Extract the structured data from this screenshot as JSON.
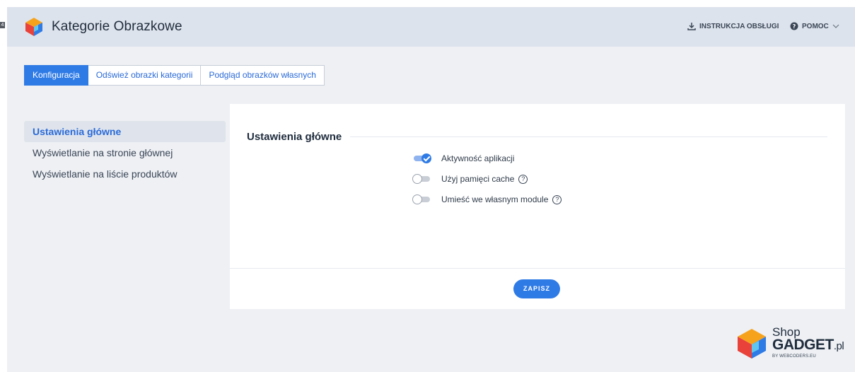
{
  "colors": {
    "accent": "#2f7be6",
    "header_bg": "#dde3ec",
    "page_bg": "#eef0f4",
    "panel_bg": "#ffffff"
  },
  "header": {
    "title": "Kategorie Obrazkowe",
    "logo_icon": "cube-logo-icon",
    "edge_tab": "4",
    "manual_label": "INSTRUKCJA OBSŁUGI",
    "manual_icon": "download-icon",
    "help_label": "POMOC",
    "help_icon": "question-circle-icon",
    "help_chevron": "chevron-down-icon"
  },
  "tabs": [
    {
      "label": "Konfiguracja",
      "active": true
    },
    {
      "label": "Odśwież obrazki kategorii",
      "active": false
    },
    {
      "label": "Podgląd obrazków własnych",
      "active": false
    }
  ],
  "sidebar": {
    "items": [
      {
        "label": "Ustawienia główne",
        "active": true
      },
      {
        "label": "Wyświetlanie na stronie głównej",
        "active": false
      },
      {
        "label": "Wyświetlanie na liście produktów",
        "active": false
      }
    ]
  },
  "panel": {
    "title": "Ustawienia główne",
    "options": [
      {
        "label": "Aktywność aplikacji",
        "enabled": true,
        "has_help": false
      },
      {
        "label": "Użyj pamięci cache",
        "enabled": false,
        "has_help": true
      },
      {
        "label": "Umieść we własnym module",
        "enabled": false,
        "has_help": true
      }
    ],
    "help_glyph": "?",
    "save_label": "ZAPISZ"
  },
  "brand": {
    "shop": "Shop",
    "gadget": "GADGET",
    "pl": ".pl",
    "by": "BY WEBCODERS.EU"
  }
}
